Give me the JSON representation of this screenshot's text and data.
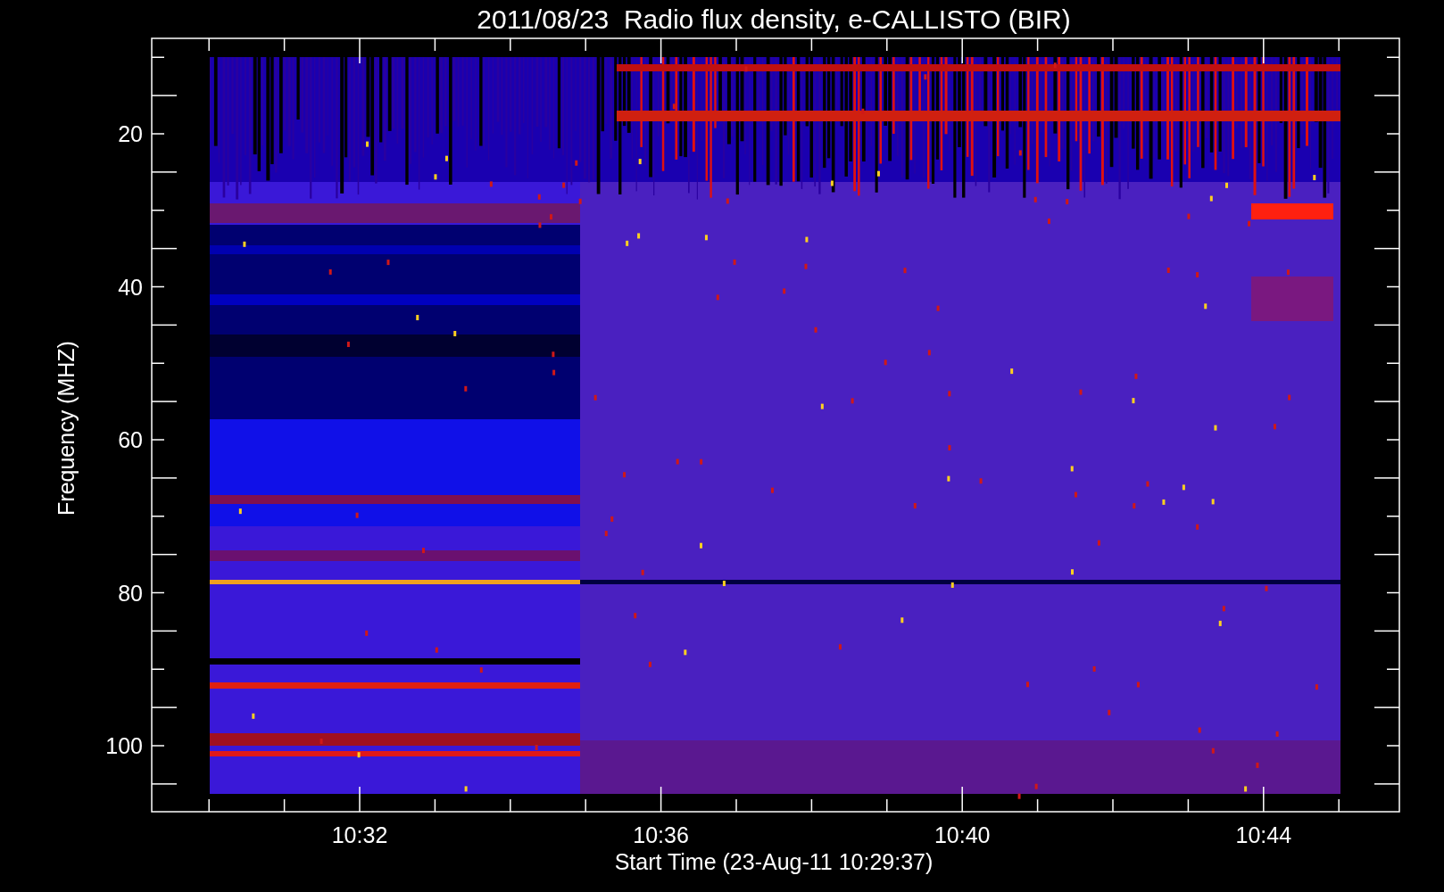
{
  "title": "2011/08/23  Radio flux density, e-CALLISTO (BIR)",
  "y_axis": {
    "label": "Frequency (MHZ)",
    "ticks": [
      "20",
      "40",
      "60",
      "80",
      "100"
    ]
  },
  "x_axis": {
    "label": "Start Time (23-Aug-11 10:29:37)",
    "ticks": [
      "10:32",
      "10:36",
      "10:40",
      "10:44"
    ]
  }
}
